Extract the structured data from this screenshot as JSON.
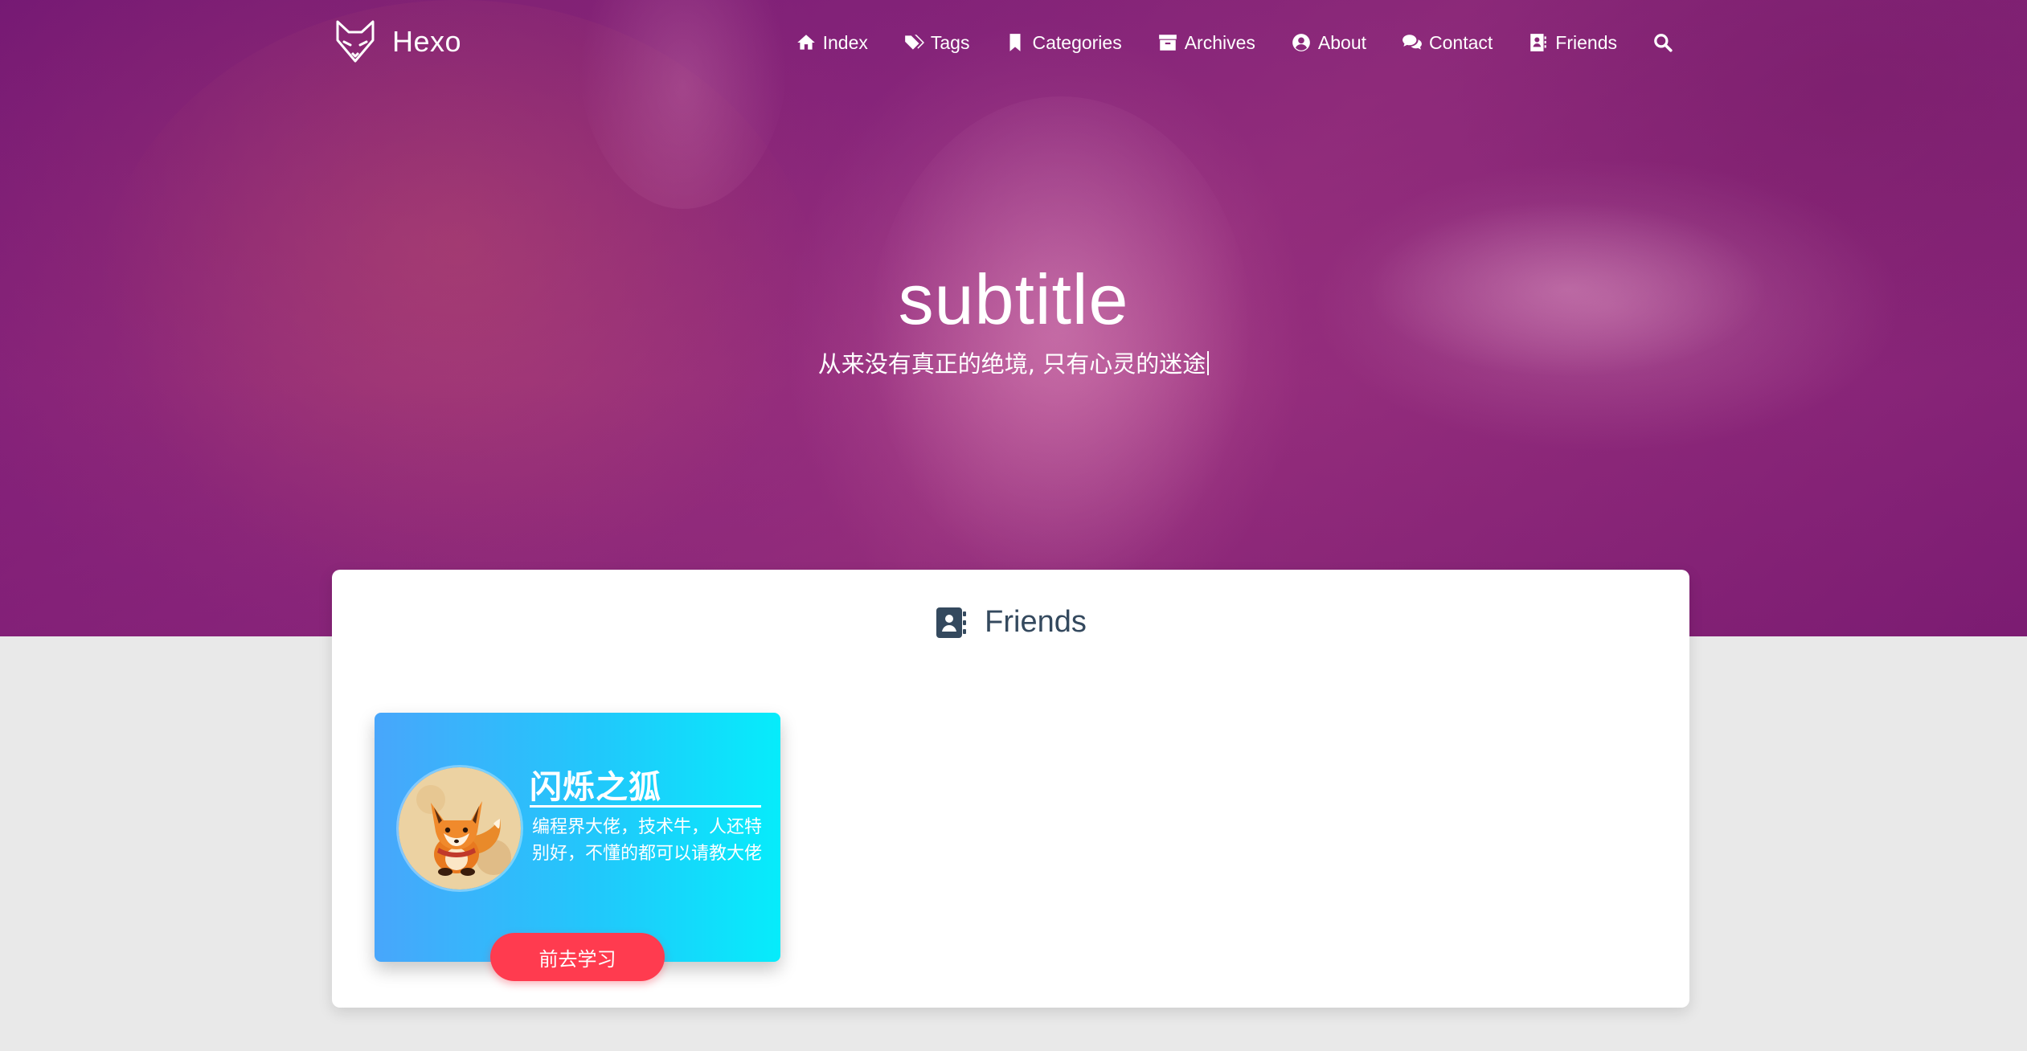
{
  "nav": {
    "brand": "Hexo",
    "items": [
      {
        "label": "Index",
        "icon": "home-icon"
      },
      {
        "label": "Tags",
        "icon": "tags-icon"
      },
      {
        "label": "Categories",
        "icon": "bookmark-icon"
      },
      {
        "label": "Archives",
        "icon": "archive-icon"
      },
      {
        "label": "About",
        "icon": "user-circle-icon"
      },
      {
        "label": "Contact",
        "icon": "comments-icon"
      },
      {
        "label": "Friends",
        "icon": "address-book-icon"
      }
    ],
    "search_icon": "search-icon"
  },
  "hero": {
    "title": "subtitle",
    "subtitle": "从来没有真正的绝境, 只有心灵的迷途"
  },
  "section": {
    "title": "Friends",
    "icon": "address-book-icon"
  },
  "friends": [
    {
      "name": "闪烁之狐",
      "description": "编程界大佬，技术牛，人还特别好，不懂的都可以请教大佬",
      "button": "前去学习",
      "avatar_icon": "fox-avatar"
    }
  ],
  "colors": {
    "hero_overlay": "#8e2a7e",
    "card_gradient_start": "#48a6fb",
    "card_gradient_end": "#06ecfb",
    "button": "#ff3b4f",
    "section_title": "#34495e",
    "page_background": "#e9e9e9"
  }
}
